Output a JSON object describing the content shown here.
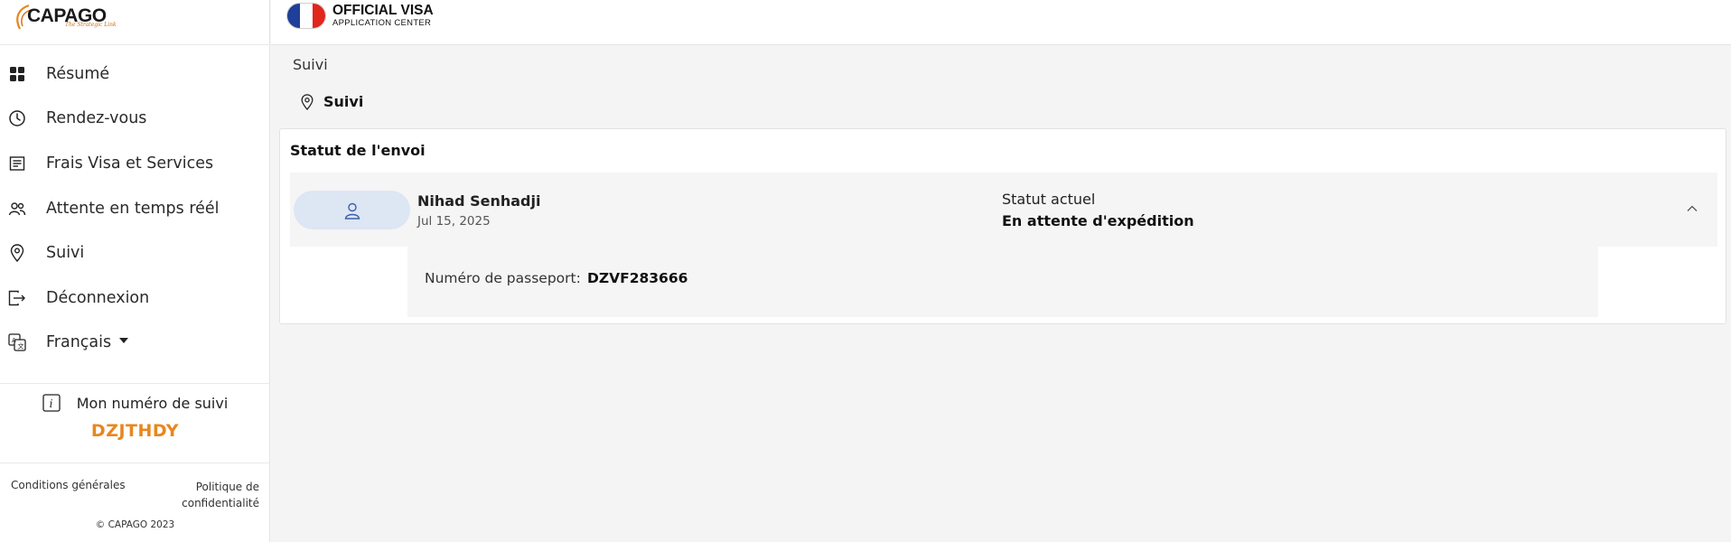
{
  "logo": {
    "name": "CAPAGO",
    "tagline": "The Strategic Link"
  },
  "header": {
    "title": "OFFICIAL VISA",
    "subtitle": "APPLICATION CENTER"
  },
  "sidebar": {
    "items": [
      {
        "label": "Résumé",
        "icon": "dashboard-icon"
      },
      {
        "label": "Rendez-vous",
        "icon": "clock-icon"
      },
      {
        "label": "Frais Visa et Services",
        "icon": "receipt-icon"
      },
      {
        "label": "Attente en temps réél",
        "icon": "people-icon"
      },
      {
        "label": "Suivi",
        "icon": "location-pin-icon"
      },
      {
        "label": "Déconnexion",
        "icon": "logout-icon"
      },
      {
        "label": "Français",
        "icon": "translate-icon"
      }
    ],
    "tracking": {
      "label": "Mon numéro de suivi",
      "code": "DZJTHDY"
    },
    "footer": {
      "terms": "Conditions générales",
      "privacy": "Politique de confidentialité",
      "copyright": "© CAPAGO 2023"
    }
  },
  "main": {
    "breadcrumb": "Suivi",
    "title": "Suivi",
    "card": {
      "title": "Statut de l'envoi",
      "applicant": {
        "name": "Nihad Senhadji",
        "date": "Jul 15, 2025",
        "status_label": "Statut actuel",
        "status_value": "En attente d'expédition"
      },
      "details": {
        "passport_label": "Numéro de passeport:",
        "passport_value": "DZVF283666"
      }
    }
  },
  "colors": {
    "accent": "#e8871e",
    "avatar_bg": "#dde6f3",
    "flag_blue": "#1f3f99",
    "flag_red": "#e1261c"
  }
}
